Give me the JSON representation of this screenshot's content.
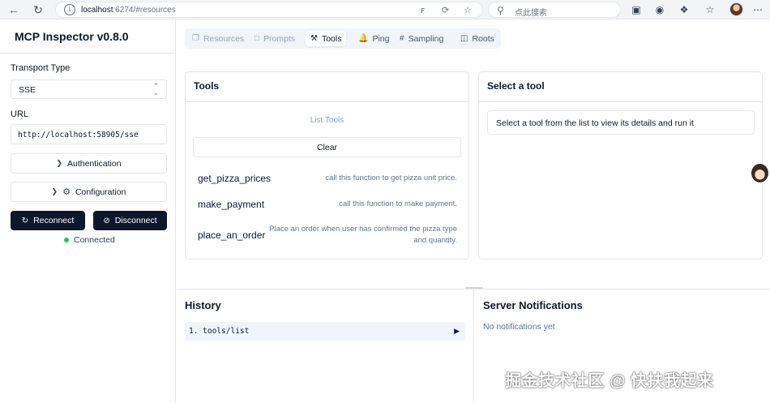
{
  "browser": {
    "url_host": "localhost",
    "url_rest": ":6274/#resources",
    "search_placeholder": "点此搜索",
    "icons": [
      "back-icon",
      "refresh-icon",
      "home-icon",
      "info-icon",
      "read-aloud-icon",
      "translate-icon",
      "favorite-icon",
      "search-icon",
      "extension-icon",
      "favorites-bar-icon",
      "profile-avatar"
    ]
  },
  "sidebar": {
    "title": "MCP Inspector v0.8.0",
    "transport_label": "Transport Type",
    "transport_value": "SSE",
    "url_label": "URL",
    "url_value": "http://localhost:58905/sse",
    "auth_label": "Authentication",
    "config_label": "Configuration",
    "reconnect_label": "Reconnect",
    "disconnect_label": "Disconnect",
    "status_text": "Connected",
    "status_color": "#22c55e"
  },
  "tabs": [
    {
      "label": "Resources",
      "icon": "resources-icon",
      "state": "disabled"
    },
    {
      "label": "Prompts",
      "icon": "prompts-icon",
      "state": "disabled"
    },
    {
      "label": "Tools",
      "icon": "tools-icon",
      "state": "active"
    },
    {
      "label": "Ping",
      "icon": "ping-icon",
      "state": "enabled"
    },
    {
      "label": "Sampling",
      "icon": "sampling-icon",
      "state": "enabled"
    },
    {
      "label": "Roots",
      "icon": "roots-icon",
      "state": "enabled"
    }
  ],
  "tools_panel": {
    "title": "Tools",
    "list_label": "List Tools",
    "clear_label": "Clear",
    "items": [
      {
        "name": "get_pizza_prices",
        "description": "call this function to get pizza unit price."
      },
      {
        "name": "make_payment",
        "description": "call this function to make payment."
      },
      {
        "name": "place_an_order",
        "description": "Place an order when user has confirmed the pizza type and quantity."
      }
    ]
  },
  "detail_panel": {
    "title": "Select a tool",
    "hint": "Select a tool from the list to view its details and run it"
  },
  "history": {
    "title": "History",
    "items": [
      {
        "label": "1. tools/list"
      }
    ]
  },
  "notifications": {
    "title": "Server Notifications",
    "empty_text": "No notifications yet"
  },
  "watermark": "掘金技术社区 @ 快扶我起来"
}
